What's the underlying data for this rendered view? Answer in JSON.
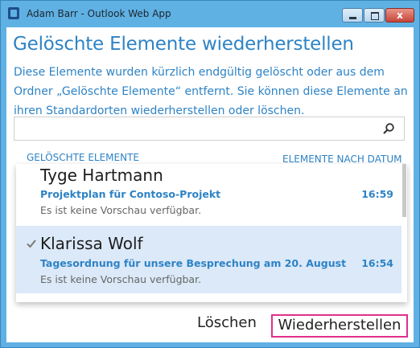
{
  "window": {
    "title": "Adam Barr - Outlook Web App",
    "close_symbol": "x"
  },
  "dialog": {
    "heading": "Gelöschte Elemente wiederherstellen",
    "description": "Diese Elemente wurden kürzlich endgültig gelöscht oder aus dem Ordner „Gelöschte Elemente“ entfernt. Sie können diese Elemente an ihren Standardorten wiederherstellen oder löschen.",
    "search": {
      "placeholder": "",
      "value": ""
    },
    "list_header_left": "GELÖSCHTE ELEMENTE",
    "list_header_right": "ELEMENTE NACH DATUM",
    "items": [
      {
        "sender": "Tyge Hartmann",
        "subject": "Projektplan für Contoso-Projekt",
        "time": "16:59",
        "preview": "Es ist keine Vorschau verfügbar.",
        "selected": false
      },
      {
        "sender": "Klarissa Wolf",
        "subject": "Tagesordnung für unsere Besprechung am 20. August",
        "time": "16:54",
        "preview": "Es ist keine Vorschau verfügbar.",
        "selected": true
      }
    ],
    "delete_label": "Löschen",
    "restore_label": "Wiederherstellen"
  },
  "colors": {
    "accent": "#2e83c5",
    "selected_bg": "#dbe9f8",
    "highlight_border": "#e0308b",
    "titlebar": "#5fb1e3"
  }
}
